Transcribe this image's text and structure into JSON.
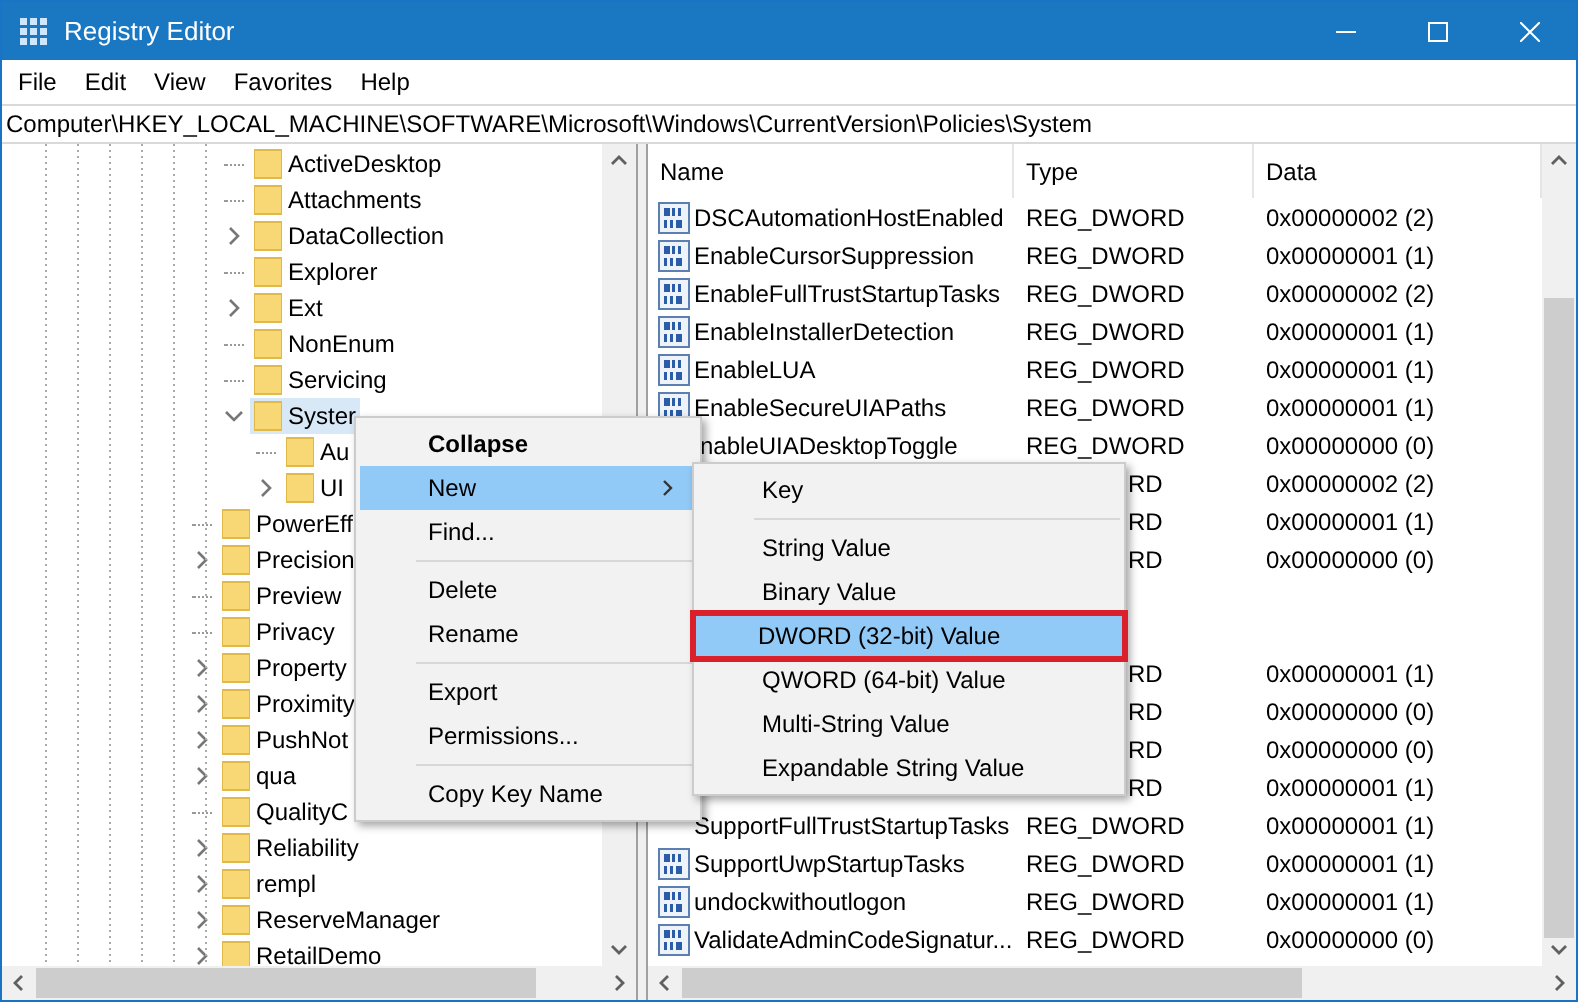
{
  "window": {
    "title": "Registry Editor"
  },
  "menu": [
    "File",
    "Edit",
    "View",
    "Favorites",
    "Help"
  ],
  "address": "Computer\\HKEY_LOCAL_MACHINE\\SOFTWARE\\Microsoft\\Windows\\CurrentVersion\\Policies\\System",
  "tree": [
    {
      "children": [
        {
          "label": "ActiveDesktop",
          "kind": "leaf",
          "selected": false
        },
        {
          "label": "Attachments",
          "kind": "leaf",
          "selected": false
        },
        {
          "label": "DataCollection",
          "kind": "collapsed",
          "selected": false
        },
        {
          "label": "Explorer",
          "kind": "leaf",
          "selected": false
        },
        {
          "label": "Ext",
          "kind": "collapsed",
          "selected": false
        },
        {
          "label": "NonEnum",
          "kind": "leaf",
          "selected": false
        },
        {
          "label": "Servicing",
          "kind": "leaf",
          "selected": false
        },
        {
          "label": "Syster",
          "kind": "expanded",
          "selected": true,
          "children": [
            {
              "label": "Au",
              "kind": "leaf",
              "selected": false
            },
            {
              "label": "UI",
              "kind": "collapsed",
              "selected": false
            }
          ]
        }
      ]
    },
    {
      "label": "PowerEff",
      "kind": "leaf",
      "selected": false
    },
    {
      "label": "Precision",
      "kind": "collapsed",
      "selected": false
    },
    {
      "label": "Preview",
      "kind": "leaf",
      "selected": false
    },
    {
      "label": "Privacy",
      "kind": "leaf",
      "selected": false
    },
    {
      "label": "Property",
      "kind": "collapsed",
      "selected": false
    },
    {
      "label": "Proximity",
      "kind": "collapsed",
      "selected": false
    },
    {
      "label": "PushNot",
      "kind": "collapsed",
      "selected": false
    },
    {
      "label": "qua",
      "kind": "collapsed",
      "selected": false
    },
    {
      "label": "QualityC",
      "kind": "leaf",
      "selected": false
    },
    {
      "label": "Reliability",
      "kind": "collapsed",
      "selected": false
    },
    {
      "label": "rempl",
      "kind": "collapsed",
      "selected": false
    },
    {
      "label": "ReserveManager",
      "kind": "collapsed",
      "selected": false
    },
    {
      "label": "RetailDemo",
      "kind": "collapsed",
      "selected": false
    }
  ],
  "values": {
    "columns": [
      "Name",
      "Type",
      "Data"
    ],
    "rows": [
      {
        "name": "DSCAutomationHostEnabled",
        "type": "REG_DWORD",
        "data": "0x00000002 (2)"
      },
      {
        "name": "EnableCursorSuppression",
        "type": "REG_DWORD",
        "data": "0x00000001 (1)"
      },
      {
        "name": "EnableFullTrustStartupTasks",
        "type": "REG_DWORD",
        "data": "0x00000002 (2)"
      },
      {
        "name": "EnableInstallerDetection",
        "type": "REG_DWORD",
        "data": "0x00000001 (1)"
      },
      {
        "name": "EnableLUA",
        "type": "REG_DWORD",
        "data": "0x00000001 (1)"
      },
      {
        "name": "EnableSecureUIAPaths",
        "type": "REG_DWORD",
        "data": "0x00000001 (1)"
      },
      {
        "name": "nableUIADesktopToggle",
        "type": "REG_DWORD",
        "data": "0x00000000 (0)",
        "kind": "name-cut"
      },
      {
        "type": "RD",
        "data": "0x00000002 (2)",
        "kind": "covered"
      },
      {
        "type": "RD",
        "data": "0x00000001 (1)",
        "kind": "covered"
      },
      {
        "type": "RD",
        "data": "0x00000000 (0)",
        "kind": "covered"
      },
      {
        "kind": "covered"
      },
      {
        "kind": "covered"
      },
      {
        "type": "RD",
        "data": "0x00000001 (1)",
        "kind": "covered"
      },
      {
        "type": "RD",
        "data": "0x00000000 (0)",
        "kind": "covered"
      },
      {
        "type": "RD",
        "data": "0x00000000 (0)",
        "kind": "covered"
      },
      {
        "type": "RD",
        "data": "0x00000001 (1)",
        "kind": "covered"
      },
      {
        "name": "SupportFullTrustStartupTasks",
        "type": "REG_DWORD",
        "data": "0x00000001 (1)",
        "kind": "icon-cut"
      },
      {
        "name": "SupportUwpStartupTasks",
        "type": "REG_DWORD",
        "data": "0x00000001 (1)"
      },
      {
        "name": "undockwithoutlogon",
        "type": "REG_DWORD",
        "data": "0x00000001 (1)"
      },
      {
        "name": "ValidateAdminCodeSignatur...",
        "type": "REG_DWORD",
        "data": "0x00000000 (0)"
      }
    ]
  },
  "context_menu": [
    {
      "label": "Collapse",
      "kind": "item",
      "bold": true,
      "selected": false
    },
    {
      "label": "New",
      "kind": "submenu",
      "bold": false,
      "selected": true
    },
    {
      "label": "Find...",
      "kind": "item",
      "bold": false,
      "selected": false
    },
    {
      "kind": "separator"
    },
    {
      "label": "Delete",
      "kind": "item",
      "bold": false,
      "selected": false
    },
    {
      "label": "Rename",
      "kind": "item",
      "bold": false,
      "selected": false
    },
    {
      "kind": "separator"
    },
    {
      "label": "Export",
      "kind": "item",
      "bold": false,
      "selected": false
    },
    {
      "label": "Permissions...",
      "kind": "item",
      "bold": false,
      "selected": false
    },
    {
      "kind": "separator"
    },
    {
      "label": "Copy Key Name",
      "kind": "item",
      "bold": false,
      "selected": false
    }
  ],
  "submenu": [
    {
      "label": "Key",
      "kind": "item",
      "selected": false,
      "highlighted": false
    },
    {
      "kind": "separator"
    },
    {
      "label": "String Value",
      "kind": "item",
      "selected": false,
      "highlighted": false
    },
    {
      "label": "Binary Value",
      "kind": "item",
      "selected": false,
      "highlighted": false
    },
    {
      "label": "DWORD (32-bit) Value",
      "kind": "item",
      "selected": true,
      "highlighted": true
    },
    {
      "label": "QWORD (64-bit) Value",
      "kind": "item",
      "selected": false,
      "highlighted": false
    },
    {
      "label": "Multi-String Value",
      "kind": "item",
      "selected": false,
      "highlighted": false
    },
    {
      "label": "Expandable String Value",
      "kind": "item",
      "selected": false,
      "highlighted": false
    }
  ]
}
